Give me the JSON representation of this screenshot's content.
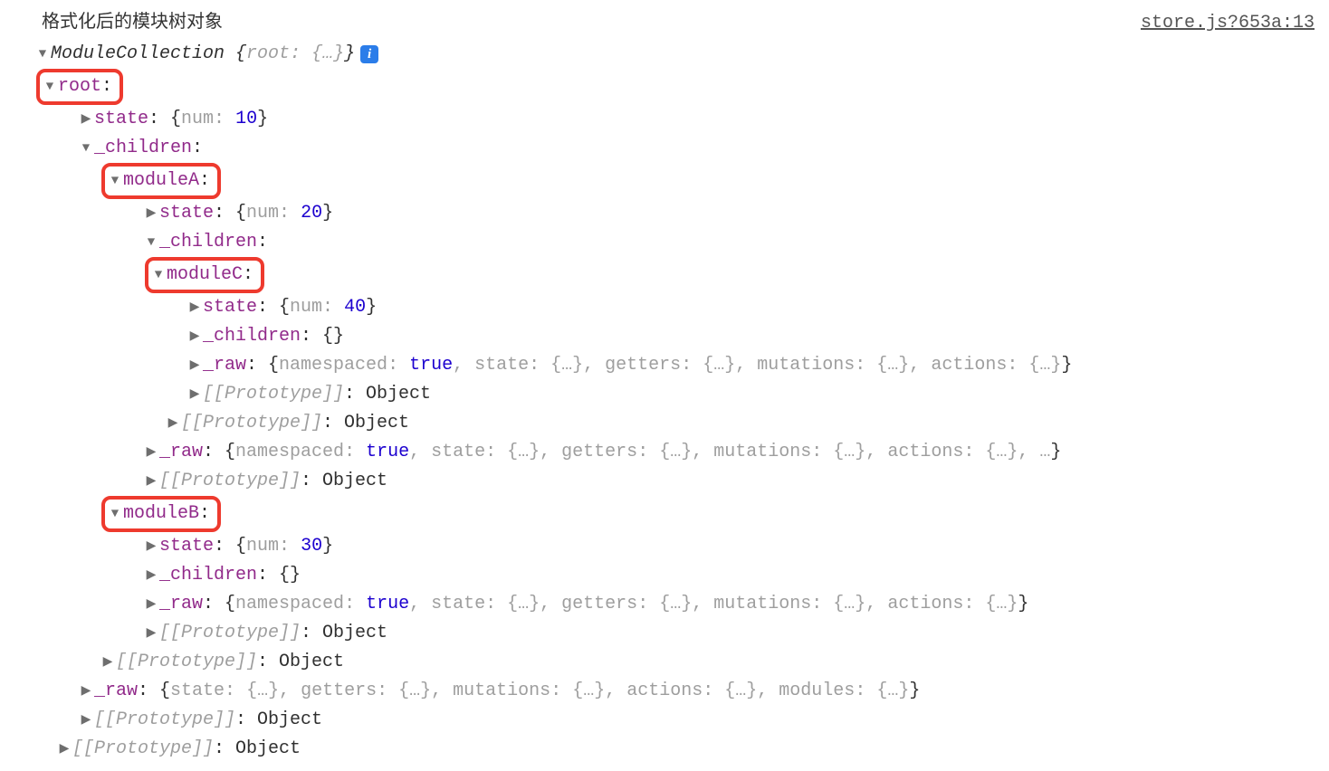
{
  "title": "格式化后的模块树对象",
  "source_link": "store.js?653a:13",
  "class_name": "ModuleCollection",
  "preview_root_key": "root",
  "object_literal": "Object",
  "ellipsis_obj": "{…}",
  "ellipsis": "…",
  "info_glyph": "i",
  "keys": {
    "root": "root",
    "state": "state",
    "num": "num",
    "children": "_children",
    "moduleA": "moduleA",
    "moduleB": "moduleB",
    "moduleC": "moduleC",
    "raw": "_raw",
    "prototype": "[[Prototype]]",
    "namespaced": "namespaced",
    "getters": "getters",
    "mutations": "mutations",
    "actions": "actions",
    "modules": "modules"
  },
  "values": {
    "root_num": "10",
    "moduleA_num": "20",
    "moduleB_num": "30",
    "moduleC_num": "40",
    "true": "true",
    "empty_obj": "{}"
  }
}
